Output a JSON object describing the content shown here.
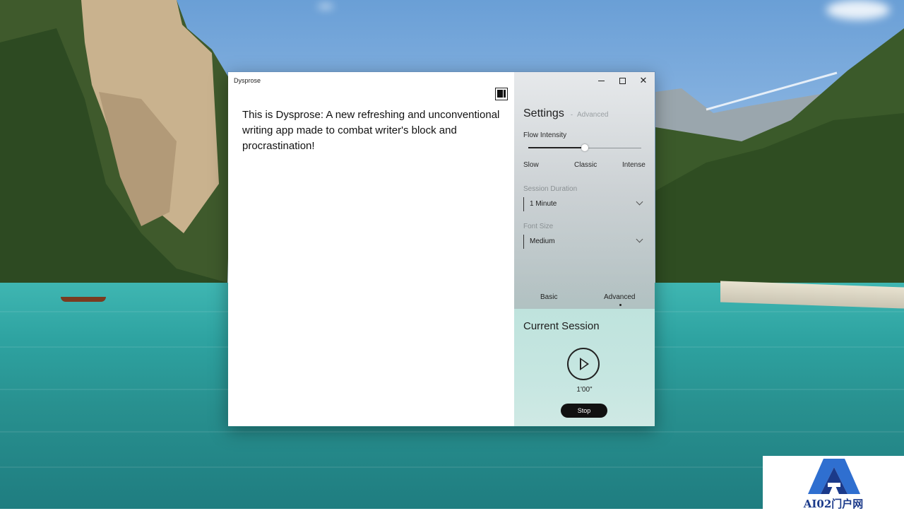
{
  "window": {
    "title": "Dysprose",
    "minimize_icon": "minimize-icon",
    "maximize_icon": "maximize-icon",
    "close_icon": "close-icon",
    "close_glyph": "✕"
  },
  "editor": {
    "text": "This is Dysprose: A new refreshing and unconventional writing app made to combat writer's block and procrastination!",
    "theme_toggle_icon": "contrast-toggle-icon"
  },
  "settings": {
    "title": "Settings",
    "separator": "-",
    "advanced_link": "Advanced",
    "flow_intensity": {
      "label": "Flow Intensity",
      "ticks": [
        "Slow",
        "Classic",
        "Intense"
      ],
      "value_fraction": 0.5
    },
    "session_duration": {
      "label": "Session Duration",
      "value": "1 Minute"
    },
    "font_size": {
      "label": "Font Size",
      "value": "Medium"
    },
    "tabs": [
      {
        "label": "Basic",
        "selected": false
      },
      {
        "label": "Advanced",
        "selected": true
      }
    ]
  },
  "session": {
    "title": "Current Session",
    "timer": "1'00\"",
    "stop_label": "Stop",
    "play_icon": "play-icon"
  },
  "watermark": {
    "text": "AI02门户网"
  },
  "colors": {
    "accent_dark": "#111111",
    "session_bg": "#cfe9e4",
    "watermark_blue": "#1b3a8a"
  }
}
